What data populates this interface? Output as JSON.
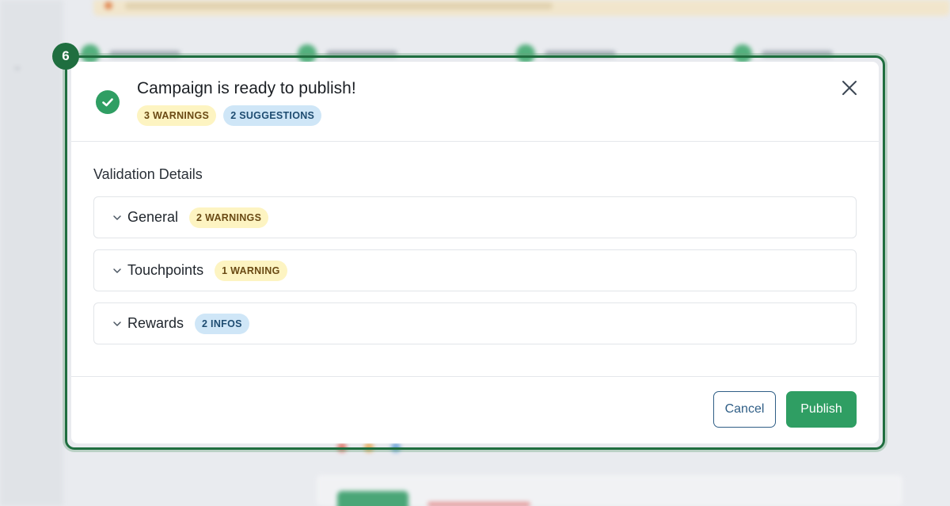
{
  "step": {
    "number": "6"
  },
  "modal": {
    "title": "Campaign is ready to publish!",
    "badges": {
      "warnings": "3 WARNINGS",
      "suggestions": "2 SUGGESTIONS"
    },
    "body_title": "Validation Details",
    "sections": [
      {
        "label": "General",
        "badge": "2 WARNINGS",
        "badge_kind": "warning"
      },
      {
        "label": "Touchpoints",
        "badge": "1 WARNING",
        "badge_kind": "warning"
      },
      {
        "label": "Rewards",
        "badge": "2 INFOS",
        "badge_kind": "info"
      }
    ],
    "buttons": {
      "cancel": "Cancel",
      "publish": "Publish"
    }
  },
  "icons": {
    "status": "check-circle-icon",
    "close": "close-icon",
    "expand": "chevron-down-icon"
  },
  "colors": {
    "primary_green": "#2f9e63",
    "outline_green": "#1f6e3f",
    "warning_bg": "#fdf4c2",
    "warning_text": "#6a4a14",
    "info_bg": "#cfe6f7",
    "info_text": "#1e4c71",
    "cancel_blue": "#2f5e86"
  }
}
